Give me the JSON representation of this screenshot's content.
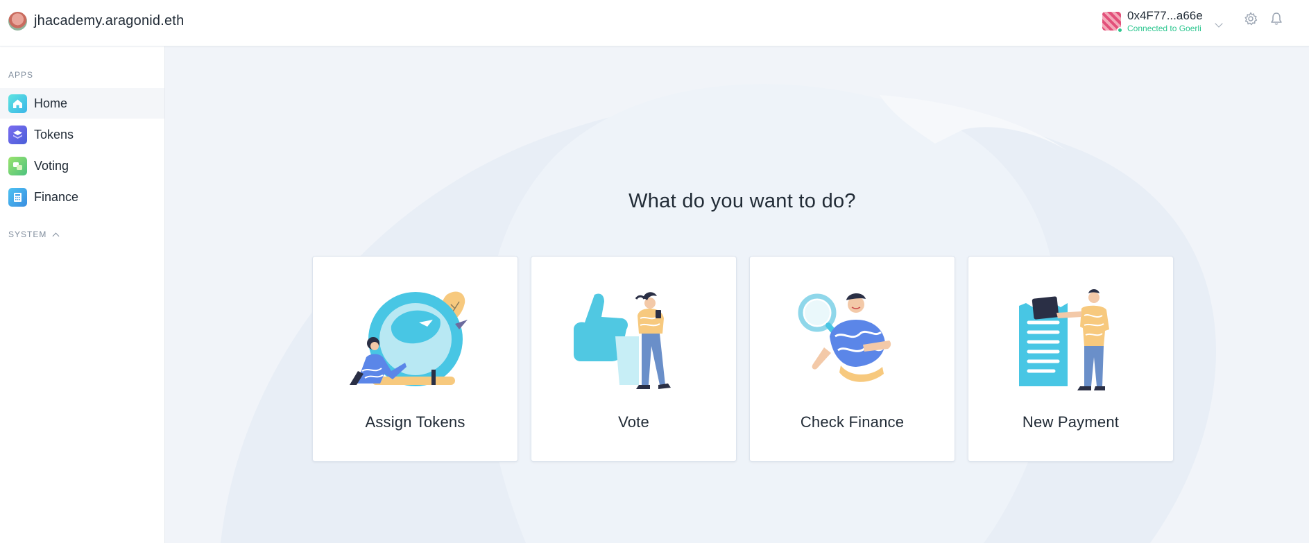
{
  "header": {
    "org_name": "jhacademy.aragonid.eth",
    "account": {
      "address": "0x4F77...a66e",
      "network_status": "Connected to Goerli"
    },
    "icons": [
      "settings-icon",
      "bell-icon",
      "chevron-down-icon"
    ]
  },
  "sidebar": {
    "apps_label": "APPS",
    "items": [
      {
        "label": "Home",
        "icon": "home-icon",
        "active": true
      },
      {
        "label": "Tokens",
        "icon": "tokens-icon",
        "active": false
      },
      {
        "label": "Voting",
        "icon": "voting-icon",
        "active": false
      },
      {
        "label": "Finance",
        "icon": "finance-icon",
        "active": false
      }
    ],
    "system_label": "SYSTEM"
  },
  "main": {
    "heading": "What do you want to do?",
    "actions": [
      {
        "label": "Assign Tokens",
        "icon": "assign-tokens-illustration"
      },
      {
        "label": "Vote",
        "icon": "vote-illustration"
      },
      {
        "label": "Check Finance",
        "icon": "check-finance-illustration"
      },
      {
        "label": "New Payment",
        "icon": "new-payment-illustration"
      }
    ]
  },
  "colors": {
    "accent": "#2cc68f",
    "text": "#212b36",
    "muted": "#7f8c9c",
    "background": "#f1f4f9",
    "illustration_cyan": "#4bcbe3"
  }
}
